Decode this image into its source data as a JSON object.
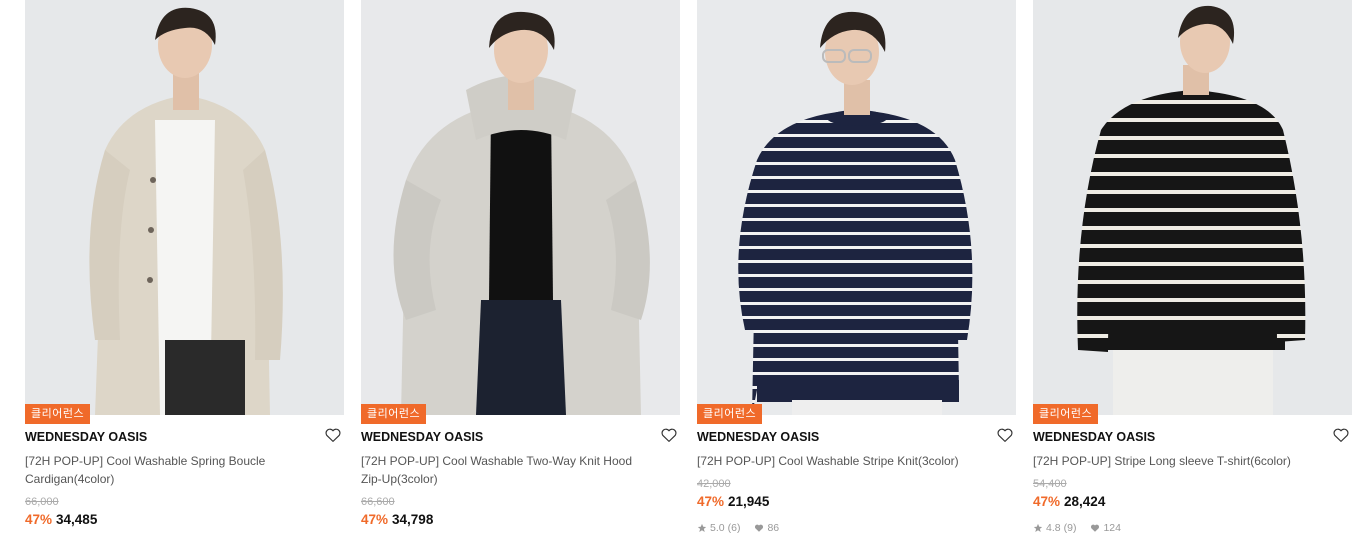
{
  "products": [
    {
      "badge": "클리어런스",
      "brand": "WEDNESDAY OASIS",
      "title": "[72H POP-UP] Cool Washable Spring Boucle Cardigan(4color)",
      "original_price": "66,000",
      "discount": "47%",
      "price": "34,485"
    },
    {
      "badge": "클리어런스",
      "brand": "WEDNESDAY OASIS",
      "title": "[72H POP-UP] Cool Washable Two-Way Knit Hood Zip-Up(3color)",
      "original_price": "66,600",
      "discount": "47%",
      "price": "34,798"
    },
    {
      "badge": "클리어런스",
      "brand": "WEDNESDAY OASIS",
      "title": "[72H POP-UP] Cool Washable Stripe Knit(3color)",
      "original_price": "42,000",
      "discount": "47%",
      "price": "21,945",
      "rating": "5.0",
      "review_count": "(6)",
      "likes": "86"
    },
    {
      "badge": "클리어런스",
      "brand": "WEDNESDAY OASIS",
      "title": "[72H POP-UP] Stripe Long sleeve T-shirt(6color)",
      "original_price": "54,400",
      "discount": "47%",
      "price": "28,424",
      "rating": "4.8",
      "review_count": "(9)",
      "likes": "124"
    }
  ],
  "colors": {
    "accent": "#f06a2a",
    "text": "#111111",
    "muted": "#999999"
  },
  "icons": {
    "wishlist": "heart-outline-icon",
    "rating": "star-icon",
    "likes": "heart-filled-icon"
  }
}
